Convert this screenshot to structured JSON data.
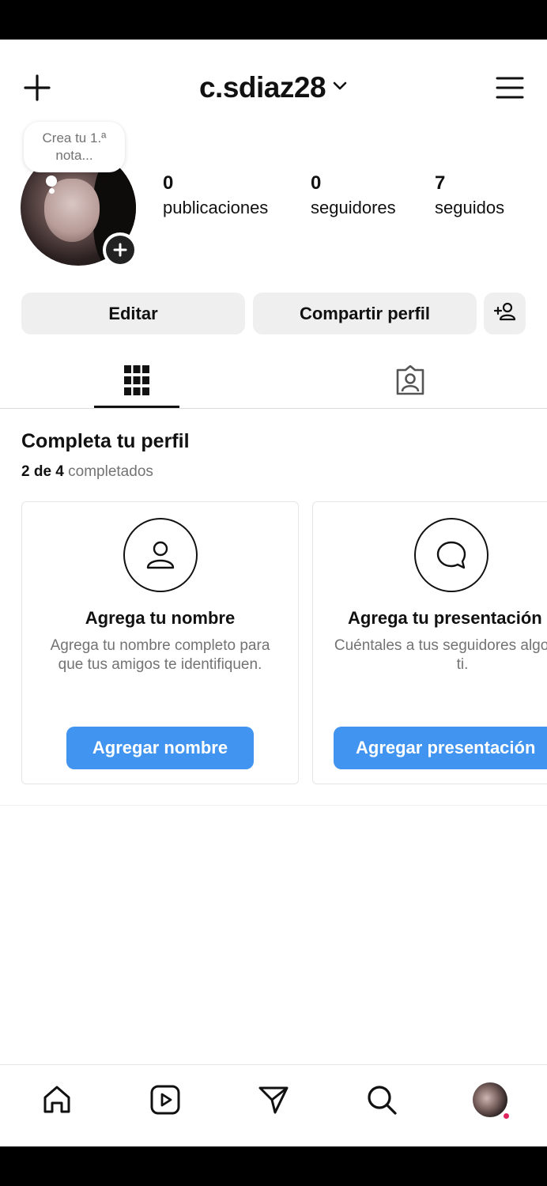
{
  "header": {
    "username": "c.sdiaz28"
  },
  "note": {
    "text": "Crea tu 1.ª nota..."
  },
  "stats": [
    {
      "value": "0",
      "label": "publicaciones"
    },
    {
      "value": "0",
      "label": "seguidores"
    },
    {
      "value": "7",
      "label": "seguidos"
    }
  ],
  "actions": {
    "edit_label": "Editar",
    "share_label": "Compartir perfil"
  },
  "tabs": [
    {
      "icon": "grid-icon",
      "active": true
    },
    {
      "icon": "tagged-photos-icon",
      "active": false
    }
  ],
  "complete_profile": {
    "title": "Completa tu perfil",
    "progress_done": "2 de 4",
    "progress_suffix": "completados",
    "cards": [
      {
        "icon": "person-icon",
        "title": "Agrega tu nombre",
        "description": "Agrega tu nombre completo para que tus amigos te identifiquen.",
        "button": "Agregar nombre"
      },
      {
        "icon": "speech-bubble-icon",
        "title": "Agrega tu presentación",
        "description": "Cuéntales a tus seguidores algo sobre ti.",
        "button": "Agregar presentación"
      }
    ]
  },
  "bottom_nav": [
    "home-icon",
    "reels-icon",
    "direct-messages-icon",
    "search-icon",
    "profile-avatar"
  ],
  "colors": {
    "primary_button": "#4194f0",
    "notification_dot": "#e0245e",
    "secondary_button": "#efefef"
  }
}
